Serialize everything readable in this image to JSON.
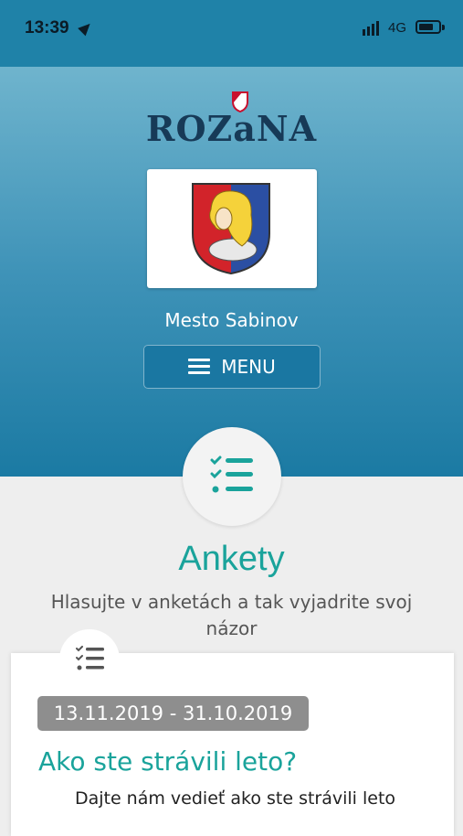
{
  "status_bar": {
    "time": "13:39",
    "network": "4G",
    "battery_level": 0.75
  },
  "header": {
    "brand": "ROZaNA",
    "town": "Mesto Sabinov",
    "menu_label": "MENU"
  },
  "section": {
    "title": "Ankety",
    "subtitle": "Hlasujte v anketách a tak vyjadrite svoj názor"
  },
  "poll": {
    "date_range": "13.11.2019 - 31.10.2019",
    "title": "Ako ste strávili leto?",
    "description": "Dajte nám vedieť ako ste strávili leto"
  },
  "colors": {
    "accent": "#1aa39b",
    "header_blue": "#1f82a8",
    "brand_dark": "#173a57"
  }
}
